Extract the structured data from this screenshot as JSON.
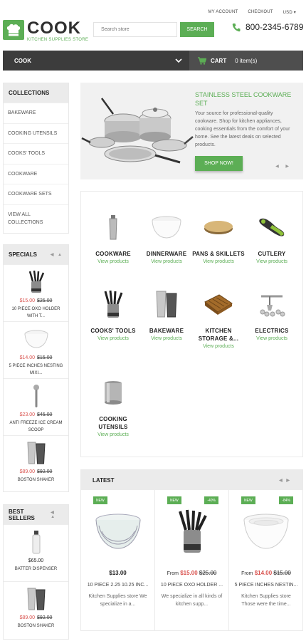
{
  "header": {
    "links": [
      "MY ACCOUNT",
      "CHECKOUT",
      "USD ▾"
    ],
    "logo_title": "COOK",
    "logo_sub": "KITCHEN SUPPLIES STORE",
    "search_placeholder": "Search store",
    "search_button": "SEARCH",
    "phone": "800-2345-6789"
  },
  "nav": {
    "menu_label": "COOK",
    "cart_label": "CART",
    "cart_count": "0 item(s)"
  },
  "collections": {
    "title": "COLLECTIONS",
    "items": [
      "BAKEWARE",
      "COOKING UTENSILS",
      "COOKS' TOOLS",
      "COOKWARE",
      "COOKWARE SETS",
      "VIEW ALL\nCOLLECTIONS"
    ]
  },
  "specials": {
    "title": "SPECIALS",
    "items": [
      {
        "new": "$15.00",
        "old": "$25.00",
        "name": "10 PIECE OXO HOLDER WITH T..."
      },
      {
        "new": "$14.00",
        "old": "$15.00",
        "name": "5 PIECE INCHES NESTING MIXI..."
      },
      {
        "new": "$23.00",
        "old": "$45.00",
        "name": "ANTI FREEZE ICE CREAM SCOOP"
      },
      {
        "new": "$89.00",
        "old": "$92.00",
        "name": "BOSTON SHAKER"
      }
    ]
  },
  "bestsellers": {
    "title": "BEST SELLERS",
    "items": [
      {
        "price": "$65.00",
        "name": "BATTER DISPENSER"
      },
      {
        "new": "$89.00",
        "old": "$92.00",
        "name": "BOSTON SHAKER"
      }
    ]
  },
  "banner": {
    "title": "STAINLESS STEEL COOKWARE SET",
    "text": "Your source for professional-quality cookware. Shop for kitchen appliances, cooking essentials from the comfort of your home. See the latest deals on selected products.",
    "button": "SHOP NOW!"
  },
  "categories": {
    "link": "View products",
    "items": [
      "COOKWARE",
      "DINNERWARE",
      "PANS & SKILLETS",
      "CUTLERY",
      "COOKS' TOOLS",
      "BAKEWARE",
      "KITCHEN STORAGE &...",
      "ELECTRICS",
      "COOKING UTENSILS"
    ]
  },
  "latest": {
    "title": "LATEST",
    "products": [
      {
        "badge": "NEW",
        "sale": "",
        "from": "",
        "price": "$13.00",
        "old": "",
        "name": "10 PIECE 2.25 10.25 INC...",
        "desc": "Kitchen Supplies store We specialize in a..."
      },
      {
        "badge": "NEW",
        "sale": "-40%",
        "from": "From",
        "price": "$15.00",
        "old": "$25.00",
        "name": "10 PIECE OXO HOLDER ...",
        "desc": "We specialize in all kinds of kitchen supp..."
      },
      {
        "badge": "NEW",
        "sale": "-84%",
        "from": "From",
        "price": "$14.00",
        "old": "$15.00",
        "name": "5 PIECE INCHES NESTIN...",
        "desc": "Kitchen Supplies store Those were the time..."
      }
    ]
  },
  "colors": {
    "accent": "#5cae55",
    "sale": "#d9534f",
    "nav": "#3c3c3c"
  }
}
